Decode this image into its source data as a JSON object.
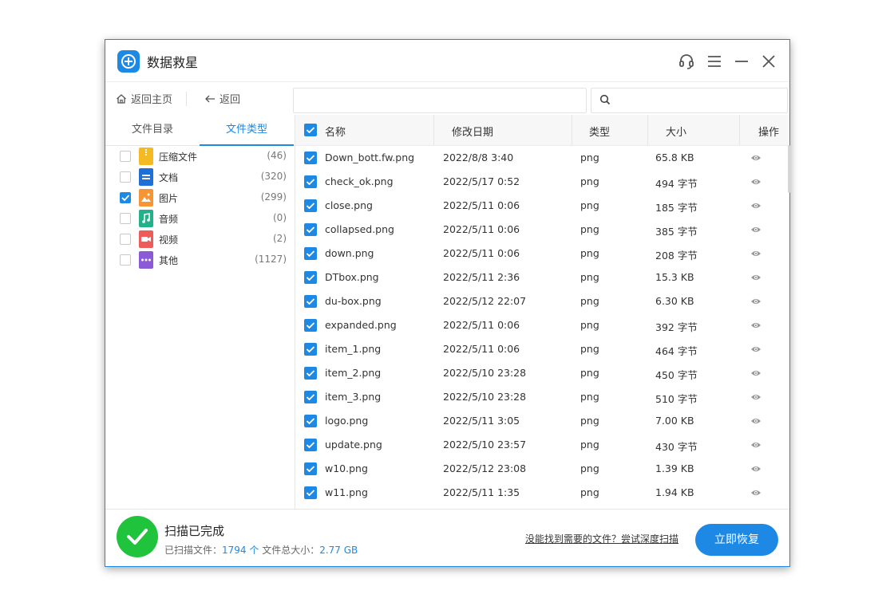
{
  "app": {
    "title": "数据救星"
  },
  "toolbar": {
    "home_label": "返回主页",
    "back_label": "返回",
    "path_value": "",
    "search_value": ""
  },
  "left_panel": {
    "tabs": [
      "文件目录",
      "文件类型"
    ],
    "active_tab": 1,
    "categories": [
      {
        "name": "压缩文件",
        "count": "(46)",
        "checked": false,
        "icon": "archive-icon",
        "color": "#f5b921"
      },
      {
        "name": "文档",
        "count": "(320)",
        "checked": false,
        "icon": "document-icon",
        "color": "#1f6fd8"
      },
      {
        "name": "图片",
        "count": "(299)",
        "checked": true,
        "icon": "image-icon",
        "color": "#f79433"
      },
      {
        "name": "音频",
        "count": "(0)",
        "checked": false,
        "icon": "audio-icon",
        "color": "#23b189"
      },
      {
        "name": "视频",
        "count": "(2)",
        "checked": false,
        "icon": "video-icon",
        "color": "#ef5a5a"
      },
      {
        "name": "其他",
        "count": "(1127)",
        "checked": false,
        "icon": "other-icon",
        "color": "#8c5ad6"
      }
    ]
  },
  "list": {
    "headers": {
      "name": "名称",
      "date": "修改日期",
      "type": "类型",
      "size": "大小",
      "action": "操作"
    },
    "rows": [
      {
        "name": "Down_bott.fw.png",
        "date": "2022/8/8 3:40",
        "type": "png",
        "size": "65.8 KB"
      },
      {
        "name": "check_ok.png",
        "date": "2022/5/17 0:52",
        "type": "png",
        "size": "494 字节"
      },
      {
        "name": "close.png",
        "date": "2022/5/11 0:06",
        "type": "png",
        "size": "185 字节"
      },
      {
        "name": "collapsed.png",
        "date": "2022/5/11 0:06",
        "type": "png",
        "size": "385 字节"
      },
      {
        "name": "down.png",
        "date": "2022/5/11 0:06",
        "type": "png",
        "size": "208 字节"
      },
      {
        "name": "DTbox.png",
        "date": "2022/5/11 2:36",
        "type": "png",
        "size": "15.3 KB"
      },
      {
        "name": "du-box.png",
        "date": "2022/5/12 22:07",
        "type": "png",
        "size": "6.30 KB"
      },
      {
        "name": "expanded.png",
        "date": "2022/5/11 0:06",
        "type": "png",
        "size": "392 字节"
      },
      {
        "name": "item_1.png",
        "date": "2022/5/11 0:06",
        "type": "png",
        "size": "464 字节"
      },
      {
        "name": "item_2.png",
        "date": "2022/5/10 23:28",
        "type": "png",
        "size": "450 字节"
      },
      {
        "name": "item_3.png",
        "date": "2022/5/10 23:28",
        "type": "png",
        "size": "510 字节"
      },
      {
        "name": "logo.png",
        "date": "2022/5/11 3:05",
        "type": "png",
        "size": "7.00 KB"
      },
      {
        "name": "update.png",
        "date": "2022/5/10 23:57",
        "type": "png",
        "size": "430 字节"
      },
      {
        "name": "w10.png",
        "date": "2022/5/12 23:08",
        "type": "png",
        "size": "1.39 KB"
      },
      {
        "name": "w11.png",
        "date": "2022/5/11 1:35",
        "type": "png",
        "size": "1.94 KB"
      }
    ]
  },
  "footer": {
    "status_title": "扫描已完成",
    "scanned_label": "已扫描文件：",
    "scanned_count": "1794 个",
    "total_label": "文件总大小：",
    "total_size": "2.77 GB",
    "deep_scan_link": "没能找到需要的文件？尝试深度扫描",
    "recover_button": "立即恢复"
  },
  "colors": {
    "accent": "#1e88e5",
    "success": "#20c33c"
  }
}
